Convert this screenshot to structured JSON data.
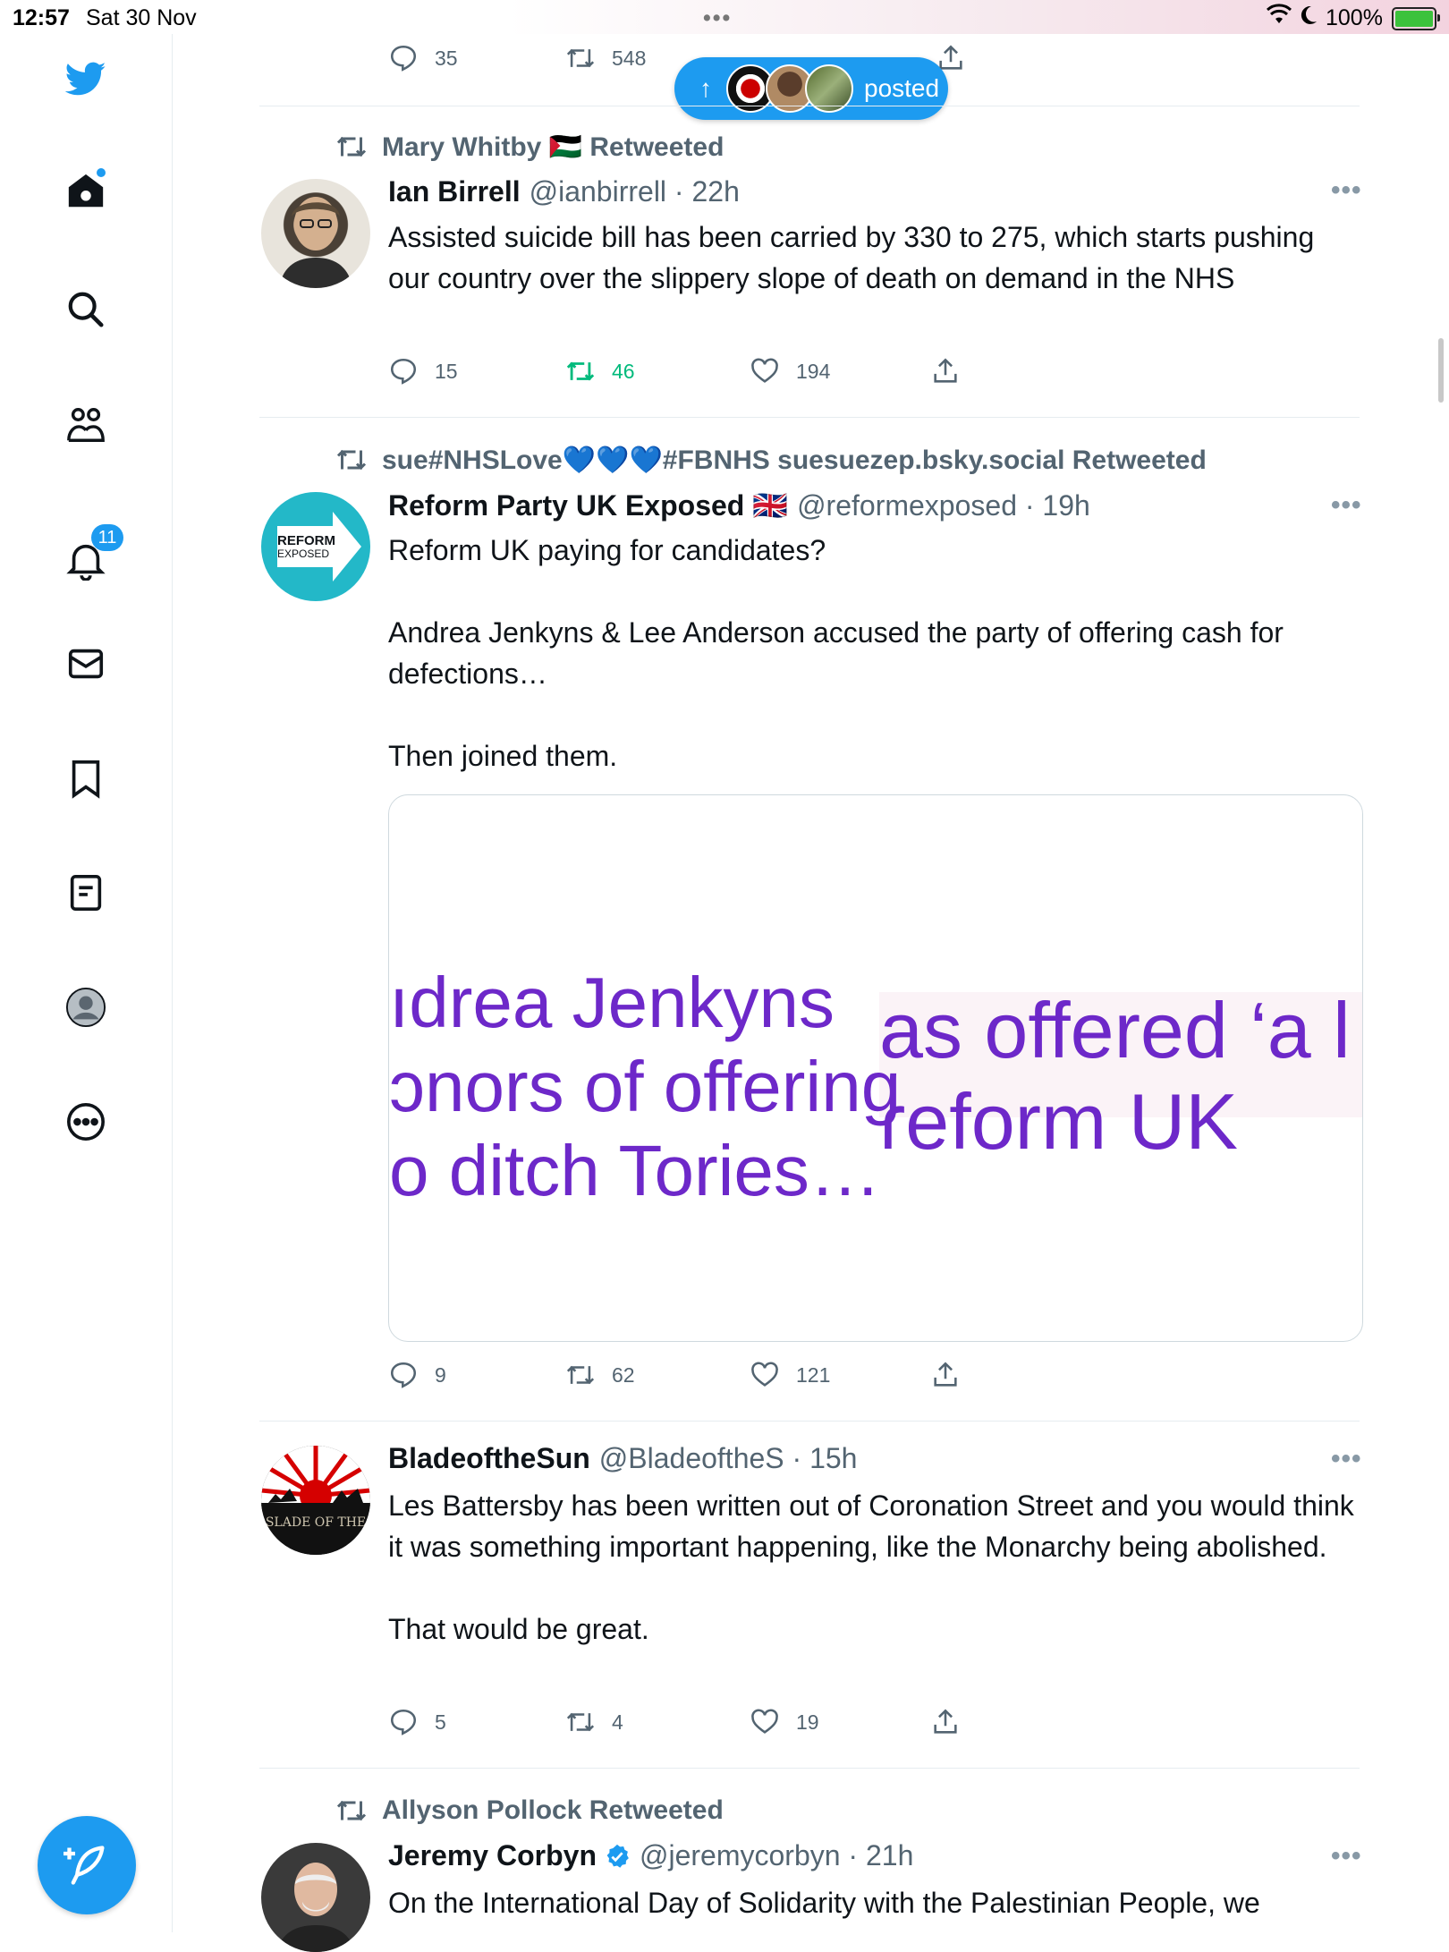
{
  "status_bar": {
    "time": "12:57",
    "date": "Sat 30 Nov",
    "battery": "100%"
  },
  "sidebar": {
    "notifications_badge": "11"
  },
  "new_posts_pill": {
    "label": "posted"
  },
  "top_tweet": {
    "reply_count": "35",
    "retweet_count": "548"
  },
  "tweets": [
    {
      "retweeted_by": "Mary Whitby 🇵🇸 Retweeted",
      "name": "Ian Birrell",
      "handle": "@ianbirrell · 22h",
      "text": "Assisted suicide bill has been carried by 330 to 275, which starts pushing our country over the slippery slope of death on demand in the NHS",
      "replies": "15",
      "retweets": "46",
      "likes": "194"
    },
    {
      "retweeted_by": "sue#NHSLove💙💙💙#FBNHS suesuezep.bsky.social Retweeted",
      "name": "Reform Party UK Exposed 🇬🇧",
      "handle": "@reformexposed · 19h",
      "avatar_text_1": "REFORM",
      "avatar_text_2": "EXPOSED",
      "text": "Reform UK paying for candidates?\n\nAndrea Jenkyns & Lee Anderson accused the party of offering cash for defections…\n\nThen joined them.",
      "media_lines_left": [
        "ıdrea Jenkyns",
        "ɔnors of offering",
        "o ditch Tories…"
      ],
      "media_lines_right": [
        "as offered ‘a l",
        "ɾeform UK"
      ],
      "replies": "9",
      "retweets": "62",
      "likes": "121"
    },
    {
      "name": "BladeoftheSun",
      "handle": "@BladeoftheS · 15h",
      "avatar_text": "SLADE OF THE",
      "text": "Les Battersby has been written out of Coronation Street and you would think it was something important happening, like the Monarchy being abolished.\n\nThat would be great.",
      "replies": "5",
      "retweets": "4",
      "likes": "19"
    },
    {
      "retweeted_by": "Allyson Pollock Retweeted",
      "name": "Jeremy Corbyn",
      "handle": "@jeremycorbyn · 21h",
      "text": "On the International Day of Solidarity with the Palestinian People, we"
    }
  ],
  "colors": {
    "accent": "#1d9bf0",
    "retweet_active": "#00ba7c",
    "secondary_text": "#536471",
    "media_text": "#6d28c9"
  },
  "icons": [
    "twitter-logo-icon",
    "home-icon",
    "search-icon",
    "communities-icon",
    "bell-icon",
    "mail-icon",
    "bookmark-icon",
    "lists-icon",
    "profile-icon",
    "more-icon",
    "compose-icon",
    "reply-icon",
    "retweet-icon",
    "like-icon",
    "share-icon",
    "verified-icon"
  ]
}
